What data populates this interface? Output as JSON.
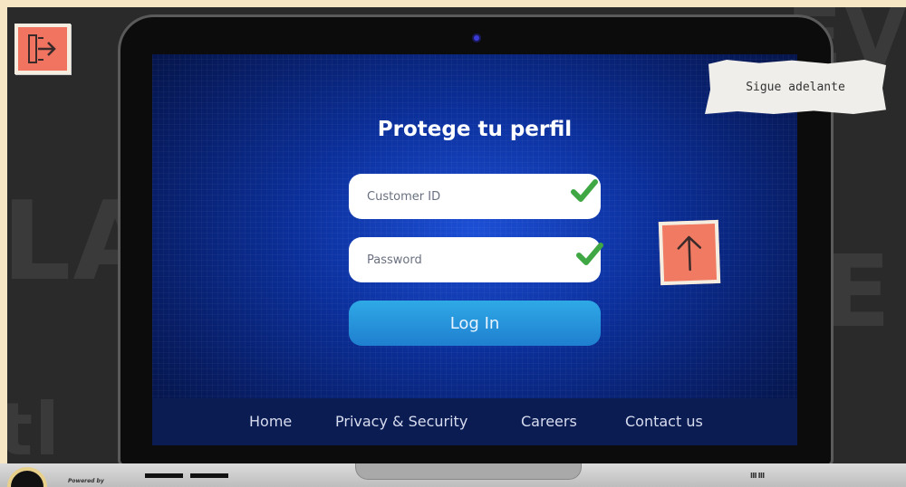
{
  "login": {
    "title": "Protege tu perfil",
    "customer_id_placeholder": "Customer ID",
    "password_placeholder": "Password",
    "login_button": "Log In"
  },
  "footer": {
    "links": [
      "Home",
      "Privacy & Security",
      "Careers",
      "Contact us"
    ]
  },
  "note": {
    "text": "Sigue adelante"
  },
  "base": {
    "powered_by": "Powered by"
  },
  "colors": {
    "screen_blue": "#0b2f9a",
    "login_button": "#2fa9e6",
    "check_green": "#3fa845",
    "sticker_coral": "#f0745f"
  },
  "icons": [
    "exit-icon",
    "up-arrow-icon",
    "check-icon",
    "camera-icon"
  ]
}
